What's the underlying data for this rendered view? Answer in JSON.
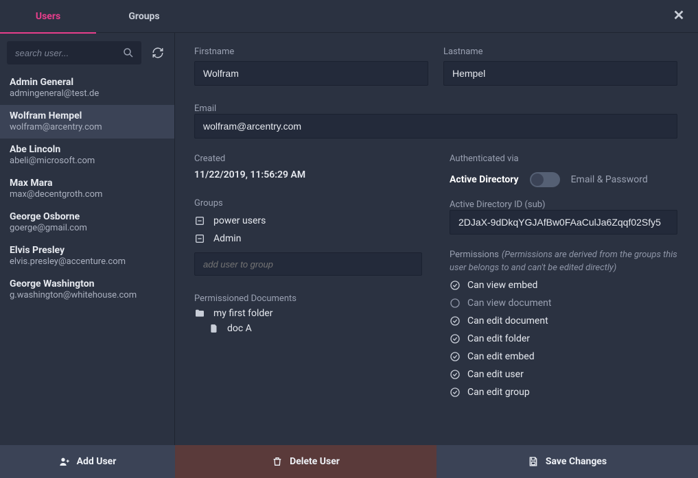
{
  "tabs": {
    "users": "Users",
    "groups": "Groups"
  },
  "sidebar": {
    "search_placeholder": "search user...",
    "users": [
      {
        "name": "Admin General",
        "email": "admingeneral@test.de"
      },
      {
        "name": "Wolfram Hempel",
        "email": "wolfram@arcentry.com"
      },
      {
        "name": "Abe Lincoln",
        "email": "abeli@microsoft.com"
      },
      {
        "name": "Max Mara",
        "email": "max@decentgroth.com"
      },
      {
        "name": "George Osborne",
        "email": "goerge@gmail.com"
      },
      {
        "name": "Elvis Presley",
        "email": "elvis.presley@accenture.com"
      },
      {
        "name": "George Washington",
        "email": "g.washington@whitehouse.com"
      }
    ]
  },
  "detail": {
    "firstname_label": "Firstname",
    "lastname_label": "Lastname",
    "email_label": "Email",
    "firstname": "Wolfram",
    "lastname": "Hempel",
    "email": "wolfram@arcentry.com",
    "created_label": "Created",
    "created_value": "11/22/2019, 11:56:29 AM",
    "groups_label": "Groups",
    "groups": [
      "power users",
      "Admin"
    ],
    "add_group_placeholder": "add user to group",
    "permdocs_label": "Permissioned Documents",
    "permdocs": {
      "folder": "my first folder",
      "file": "doc A"
    },
    "auth_label": "Authenticated via",
    "auth_ad": "Active Directory",
    "auth_ep": "Email & Password",
    "adid_label": "Active Directory ID (sub)",
    "adid_value": "2DJaX-9dDkqYGJAfBw0FAaCulJa6Zqqf02Sfy5",
    "permissions_label": "Permissions",
    "permissions_note": "(Permissions are derived from the groups this user belongs to and can't be edited directly)",
    "permissions": [
      {
        "on": true,
        "label": "Can view embed"
      },
      {
        "on": false,
        "label": "Can view document"
      },
      {
        "on": true,
        "label": "Can edit document"
      },
      {
        "on": true,
        "label": "Can edit folder"
      },
      {
        "on": true,
        "label": "Can edit embed"
      },
      {
        "on": true,
        "label": "Can edit user"
      },
      {
        "on": true,
        "label": "Can edit group"
      }
    ]
  },
  "footer": {
    "add": "Add User",
    "delete": "Delete User",
    "save": "Save Changes"
  }
}
